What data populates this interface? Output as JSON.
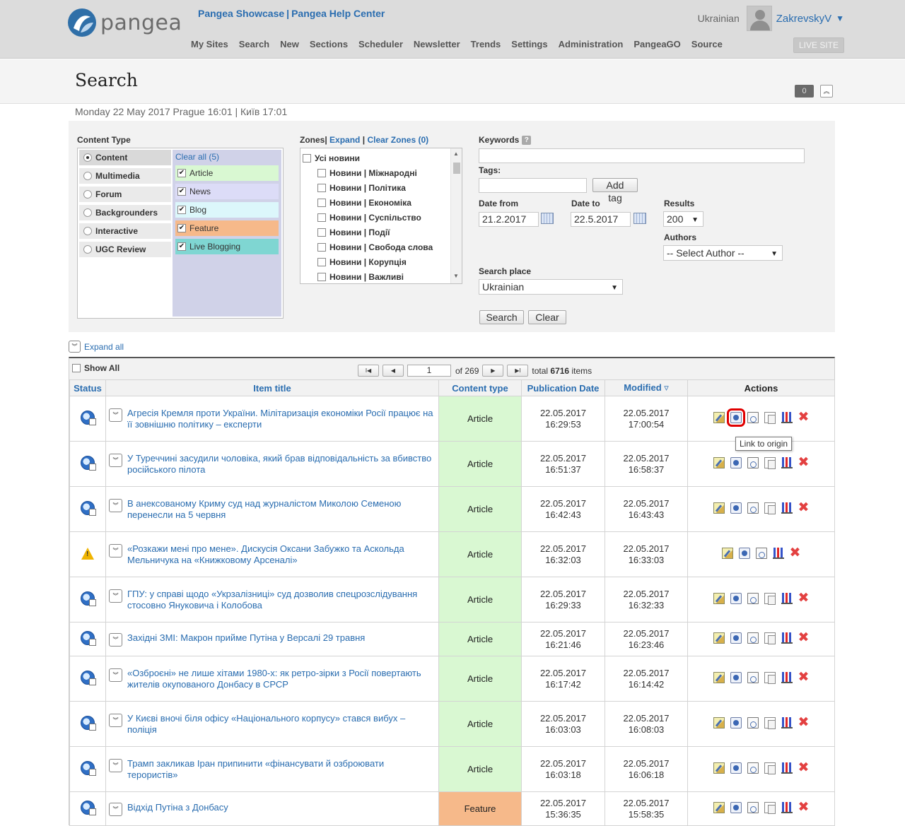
{
  "header": {
    "logo_text": "pangea",
    "showcase_link": "Pangea Showcase",
    "separator": "|",
    "help_link": "Pangea Help Center",
    "nav": [
      "My Sites",
      "Search",
      "New",
      "Sections",
      "Scheduler",
      "Newsletter",
      "Trends",
      "Settings",
      "Administration",
      "PangeaGO",
      "Source"
    ],
    "language": "Ukrainian",
    "username": "ZakrevskyV",
    "live_site": "LIVE SITE"
  },
  "titlebar": {
    "title": "Search",
    "counter": "0",
    "datetime": "Monday 22 May 2017 Prague 16:01 | Київ 17:01"
  },
  "search": {
    "content_type_label": "Content Type",
    "categories": [
      {
        "label": "Content",
        "selected": true
      },
      {
        "label": "Multimedia",
        "selected": false
      },
      {
        "label": "Forum",
        "selected": false
      },
      {
        "label": "Backgrounders",
        "selected": false
      },
      {
        "label": "Interactive",
        "selected": false
      },
      {
        "label": "UGC Review",
        "selected": false
      }
    ],
    "clear_all": "Clear all (5)",
    "types": [
      {
        "label": "Article",
        "color": "#d9f8d2"
      },
      {
        "label": "News",
        "color": "#dcdcf7"
      },
      {
        "label": "Blog",
        "color": "#dcf7fb"
      },
      {
        "label": "Feature",
        "color": "#f6b98a"
      },
      {
        "label": "Live Blogging",
        "color": "#7fd6d2"
      }
    ],
    "zones_label": "Zones|",
    "zones_expand": "Expand",
    "zones_sep": "|",
    "zones_clear": "Clear Zones (0)",
    "zones": [
      "Усі новини",
      "Новини | Міжнародні",
      "Новини | Політика",
      "Новини | Економіка",
      "Новини | Суспільство",
      "Новини | Події",
      "Новини | Свобода слова",
      "Новини | Корупція",
      "Новини | Важливі"
    ],
    "keywords_label": "Keywords",
    "keywords_value": "",
    "tags_label": "Tags:",
    "tags_value": "",
    "add_tag": "Add tag",
    "date_from_label": "Date from",
    "date_from": "21.2.2017",
    "date_to_label": "Date to",
    "date_to": "22.5.2017",
    "results_label": "Results",
    "results_value": "200",
    "authors_label": "Authors",
    "authors_value": "-- Select Author --",
    "search_place_label": "Search place",
    "search_place": "Ukrainian",
    "search_button": "Search",
    "clear_button": "Clear"
  },
  "results": {
    "expand_all": "Expand all",
    "show_all": "Show All",
    "page": "1",
    "of_pages": "of 269",
    "total_prefix": "total",
    "total_count": "6716",
    "total_suffix": "items",
    "columns": {
      "status": "Status",
      "title": "Item title",
      "content_type": "Content type",
      "pub_date": "Publication Date",
      "modified": "Modified ▿",
      "actions": "Actions"
    },
    "tooltip": "Link to origin",
    "rows": [
      {
        "status": "published",
        "title": "Агресія Кремля проти України. Мілітаризація економіки Росії працює на її зовнішню політику – експерти",
        "type": "Article",
        "pub_date": "22.05.2017",
        "pub_time": "16:29:53",
        "mod_date": "22.05.2017",
        "mod_time": "17:00:54",
        "has_copy": true
      },
      {
        "status": "published",
        "title": "У Туреччині засудили чоловіка, який брав відповідальність за вбивство російського пілота",
        "type": "Article",
        "pub_date": "22.05.2017",
        "pub_time": "16:51:37",
        "mod_date": "22.05.2017",
        "mod_time": "16:58:37",
        "has_copy": true
      },
      {
        "status": "published",
        "title": "В анексованому Криму суд над журналістом Миколою Семеною перенесли на 5 червня",
        "type": "Article",
        "pub_date": "22.05.2017",
        "pub_time": "16:42:43",
        "mod_date": "22.05.2017",
        "mod_time": "16:43:43",
        "has_copy": true
      },
      {
        "status": "warning",
        "title": "«Розкажи мені про мене». Дискусія Оксани Забужко та Аскольда Мельничука на «Книжковому Арсеналі»",
        "type": "Article",
        "pub_date": "22.05.2017",
        "pub_time": "16:32:03",
        "mod_date": "22.05.2017",
        "mod_time": "16:33:03",
        "has_copy": false
      },
      {
        "status": "published",
        "title": "ГПУ: у справі щодо «Укрзалізниці» суд дозволив спецрозслідування стосовно Януковича і Колобова",
        "type": "Article",
        "pub_date": "22.05.2017",
        "pub_time": "16:29:33",
        "mod_date": "22.05.2017",
        "mod_time": "16:32:33",
        "has_copy": true
      },
      {
        "status": "published",
        "title": "Західні ЗМІ: Макрон прийме Путіна у Версалі 29 травня",
        "type": "Article",
        "pub_date": "22.05.2017",
        "pub_time": "16:21:46",
        "mod_date": "22.05.2017",
        "mod_time": "16:23:46",
        "has_copy": true
      },
      {
        "status": "published",
        "title": "«Озброєні» не лише хітами 1980-х: як ретро-зірки з Росії повертають жителів окупованого Донбасу в СРСР",
        "type": "Article",
        "pub_date": "22.05.2017",
        "pub_time": "16:17:42",
        "mod_date": "22.05.2017",
        "mod_time": "16:14:42",
        "has_copy": true
      },
      {
        "status": "published",
        "title": "У Києві вночі біля офісу «Національного корпусу» стався вибух – поліція",
        "type": "Article",
        "pub_date": "22.05.2017",
        "pub_time": "16:03:03",
        "mod_date": "22.05.2017",
        "mod_time": "16:08:03",
        "has_copy": true
      },
      {
        "status": "published",
        "title": "Трамп закликав Іран припинити «фінансувати й озброювати терористів»",
        "type": "Article",
        "pub_date": "22.05.2017",
        "pub_time": "16:03:18",
        "mod_date": "22.05.2017",
        "mod_time": "16:06:18",
        "has_copy": true
      },
      {
        "status": "published",
        "title": "Відхід Путіна з Донбасу",
        "type": "Feature",
        "pub_date": "22.05.2017",
        "pub_time": "15:36:35",
        "mod_date": "22.05.2017",
        "mod_time": "15:58:35",
        "has_copy": true
      }
    ]
  }
}
